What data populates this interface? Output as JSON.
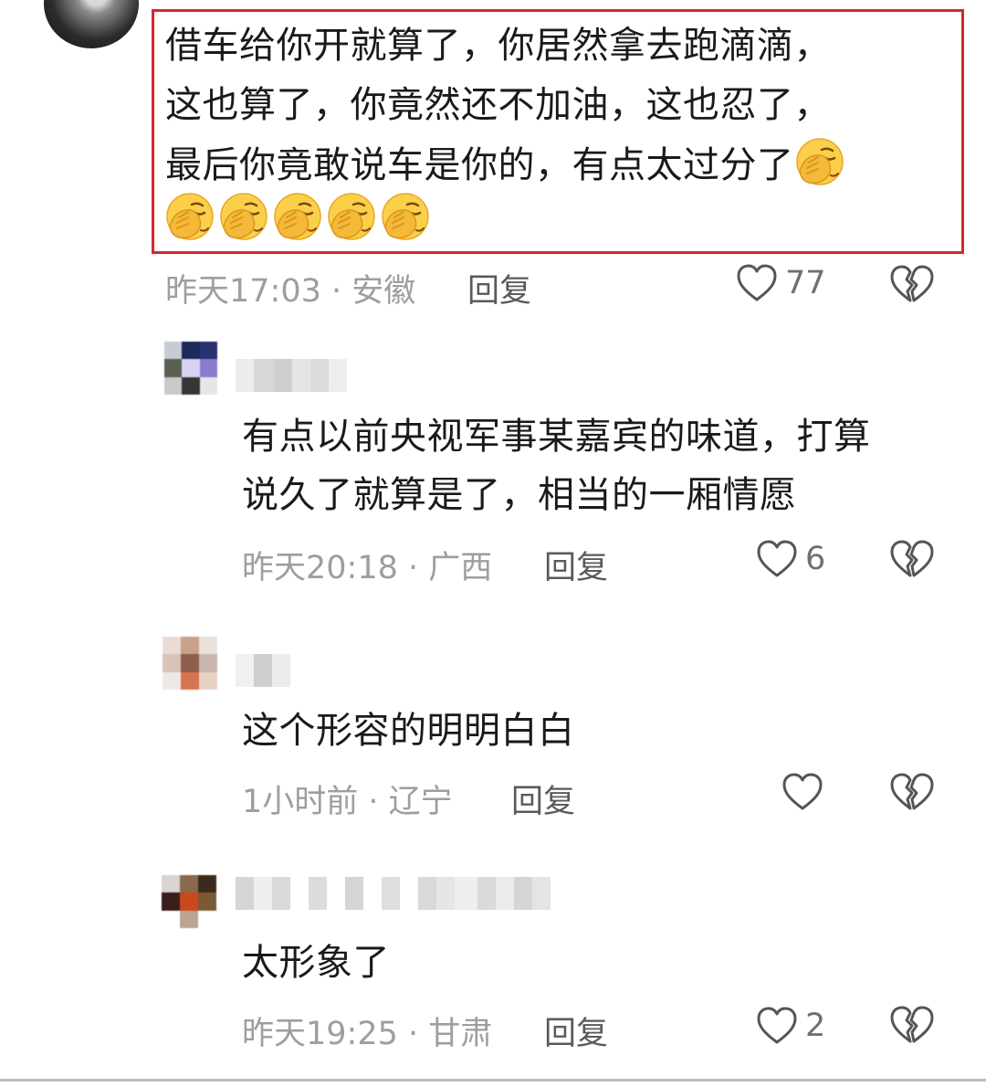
{
  "main_comment": {
    "avatar": "user-avatar",
    "text_lines": [
      "借车给你开就算了，你居然拿去跑滴滴，",
      "这也算了，你竟然还不加油，这也忍了，",
      "最后你竟敢说车是你的，有点太过分了"
    ],
    "emoji": "facepalm-emoji",
    "time_location": "昨天17:03 · 安徽",
    "reply_label": "回复",
    "likes": "77",
    "highlight_color": "#d4282e"
  },
  "replies": [
    {
      "text_lines": [
        "有点以前央视军事某嘉宾的味道，打算",
        "说久了就算是了，相当的一厢情愿"
      ],
      "time_location": "昨天20:18 · 广西",
      "reply_label": "回复",
      "likes": "6"
    },
    {
      "text_lines": [
        "这个形容的明明白白"
      ],
      "time_location": "1小时前 · 辽宁",
      "reply_label": "回复",
      "likes": ""
    },
    {
      "text_lines": [
        "太形象了"
      ],
      "time_location": "昨天19:25 · 甘肃",
      "reply_label": "回复",
      "likes": "2"
    }
  ],
  "icons": {
    "like": "heart-icon",
    "dislike": "broken-heart-icon"
  }
}
